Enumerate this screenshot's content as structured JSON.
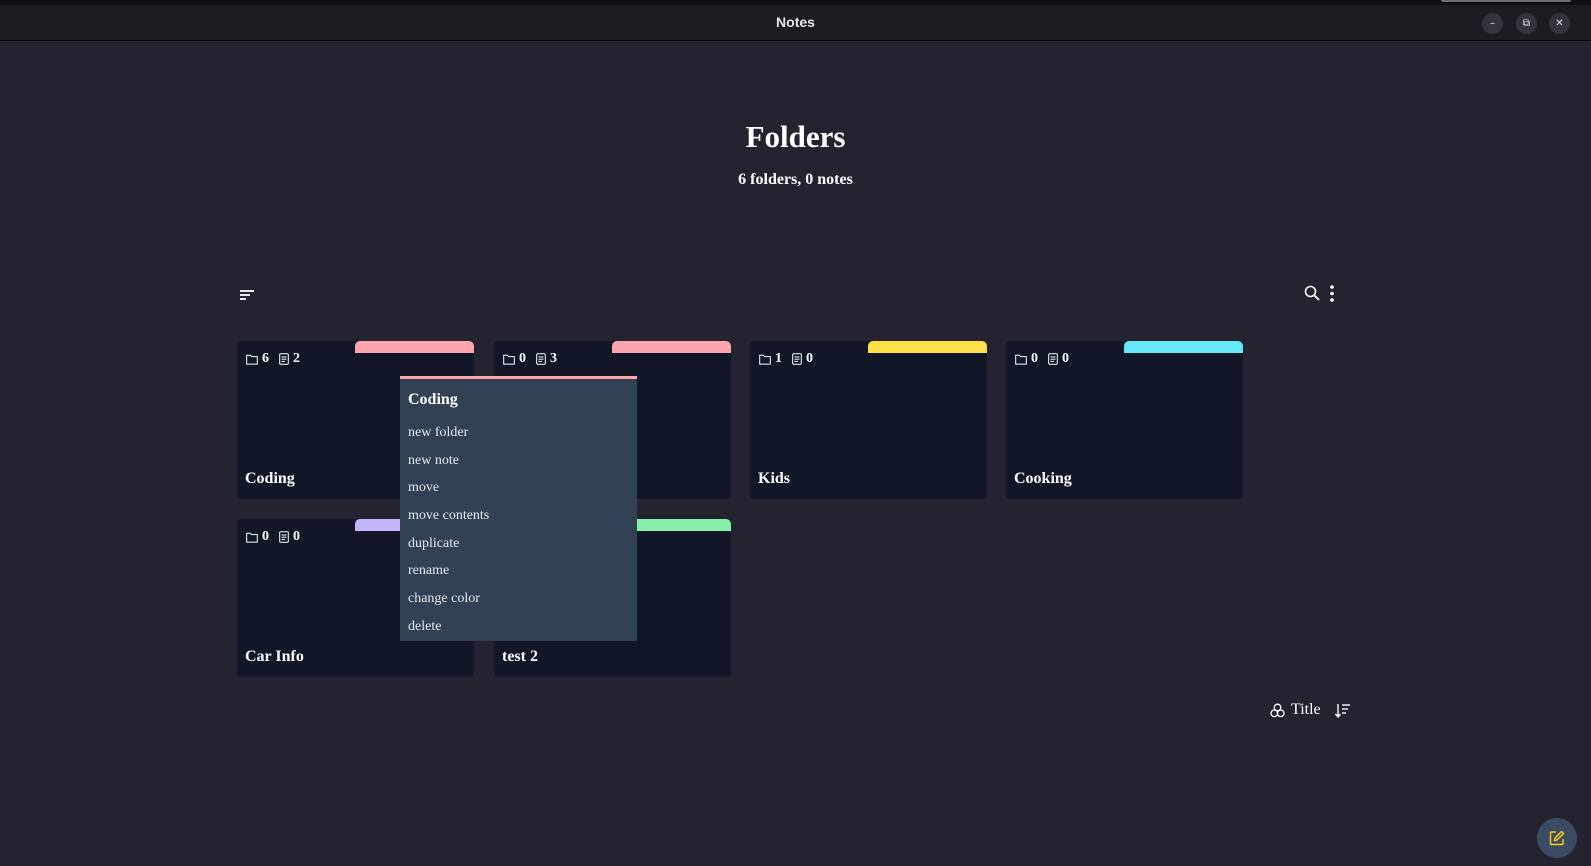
{
  "window": {
    "title": "Notes",
    "minimize_glyph": "–",
    "maximize_glyph": "⧉",
    "close_glyph": "✕"
  },
  "header": {
    "title": "Folders",
    "summary": "6 folders, 0 notes"
  },
  "toolbar": {
    "filter_icon": "filter-lines-icon",
    "search_icon": "search-icon",
    "more_icon": "more-vertical-icon"
  },
  "folders": [
    {
      "name": "Coding",
      "folders": "6",
      "notes": "2",
      "color": "#fda4af"
    },
    {
      "name": "",
      "folders": "0",
      "notes": "3",
      "color": "#fda4af"
    },
    {
      "name": "Kids",
      "folders": "1",
      "notes": "0",
      "color": "#fde047"
    },
    {
      "name": "Cooking",
      "folders": "0",
      "notes": "0",
      "color": "#67e8f9"
    },
    {
      "name": "Car Info",
      "folders": "0",
      "notes": "0",
      "color": "#c4b5fd"
    },
    {
      "name": "test 2",
      "folders": "",
      "notes": "",
      "color": "#86efac"
    }
  ],
  "context_menu": {
    "title": "Coding",
    "accent": "#fda4af",
    "items": [
      "new folder",
      "new note",
      "move",
      "move contents",
      "duplicate",
      "rename",
      "change color",
      "delete"
    ]
  },
  "sort": {
    "label": "Title",
    "group_icon": "circles-icon",
    "direction_icon": "sort-descending-icon"
  },
  "fab": {
    "icon": "edit-note-icon"
  }
}
